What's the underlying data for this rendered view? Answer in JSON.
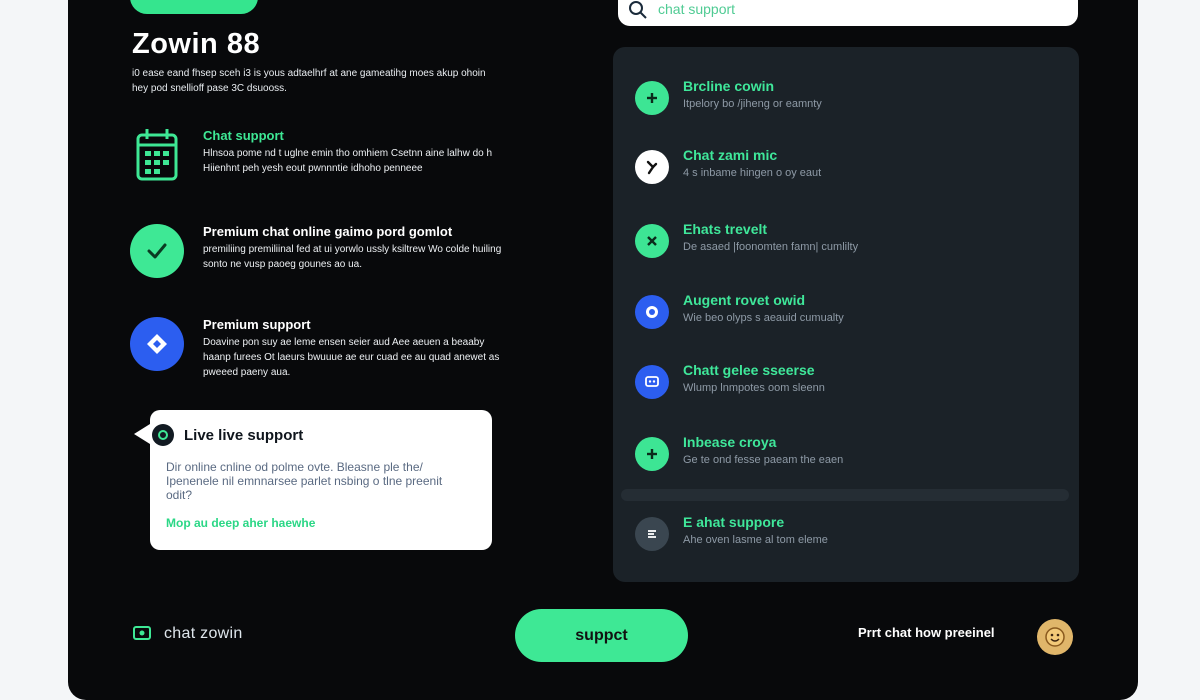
{
  "brand": "Zowin 88",
  "intro": "i0 ease eand fhsep sceh i3 is yous adtaelhrf at ane gameatihg moes akup ohoin hey pod snellioff pase 3C dsuooss.",
  "features": [
    {
      "title": "Chat support",
      "desc": "Hlnsoa pome nd t uglne emin tho omhiem Csetnn aine lalhw do h Hiienhnt peh yesh eout pwnnntie idhoho penneee",
      "icon": "calendar-icon"
    },
    {
      "title": "Premium chat  online gaimo pord gomlot",
      "desc": "premiliing premiliinal fed at ui yorwlo ussly ksiltrew Wo colde huiling sonto ne vusp paoeg gounes ao ua.",
      "icon": "check-icon"
    },
    {
      "title": "Premium support",
      "desc": "Doavine pon suy ae leme ensen seier aud Aee aeuen a beaaby haanp furees Ot laeurs bwuuue ae eur cuad ee au quad anewet as pweeed paeny aua.",
      "icon": "diamond-icon"
    }
  ],
  "bubble": {
    "title": "Live live support",
    "text": "Dir online cnline od polme ovte. Bleasne ple the/ Ipenenele nil emnnarsee parlet nsbing o tlne preenit odit?",
    "link": "Mop au deep aher haewhe"
  },
  "search": {
    "placeholder": "chat support"
  },
  "panel_items": [
    {
      "title": "Brcline cowin",
      "sub": "Itpelory bo /jiheng or eamnty",
      "icon": "plus-icon",
      "bg": "#3de594"
    },
    {
      "title": "Chat zami mic",
      "sub": "4 s inbame hingen o oy eaut",
      "icon": "bolt-icon",
      "bg": "#ffffff"
    },
    {
      "title": "Ehats trevelt",
      "sub": "De asaed |foonomten famn| cumlilty",
      "icon": "cross-icon",
      "bg": "#3de594"
    },
    {
      "title": "Augent rovet owid",
      "sub": "Wie beo olyps s aeauid cumualty",
      "icon": "shield-icon",
      "bg": "#2c5ef0"
    },
    {
      "title": "Chatt gelee sseerse",
      "sub": "Wlump lnmpotes oom sleenn",
      "icon": "chat-icon",
      "bg": "#2c5ef0"
    },
    {
      "title": "Inbease croya",
      "sub": "Ge te ond fesse paeam the eaen",
      "icon": "plus-icon",
      "bg": "#3de594"
    },
    {
      "title": "E ahat suppore",
      "sub": "Ahe oven lasme al tom eleme",
      "icon": "menu-icon",
      "bg": "#3a4650"
    }
  ],
  "footer": {
    "left_label": "chat zowin",
    "cta": "suppct",
    "right_label": "Prrt chat  how preeinel"
  },
  "colors": {
    "accent": "#3ee895",
    "background": "#08090b",
    "panel": "#1b2228",
    "blue": "#2c5ef0"
  }
}
